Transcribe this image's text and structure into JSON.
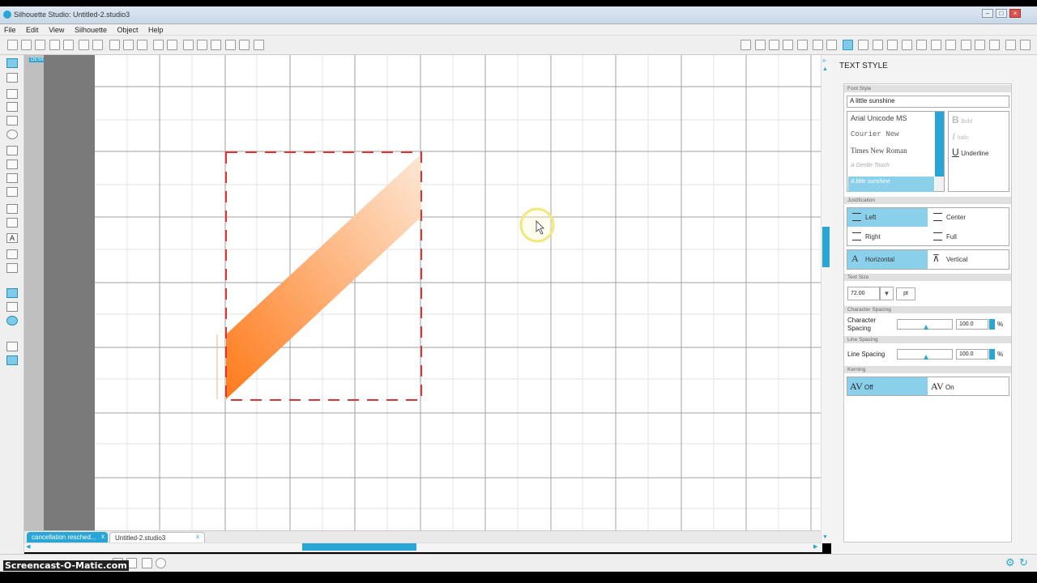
{
  "window": {
    "title": "Silhouette Studio: Untitled-2.studio3"
  },
  "menu": [
    "File",
    "Edit",
    "View",
    "Silhouette",
    "Object",
    "Help"
  ],
  "design_view_label": "DESIGN VIEW",
  "tabs": [
    {
      "label": "cancellation resched...",
      "close": "x"
    },
    {
      "label": "Untitled-2.studio3",
      "close": "x"
    }
  ],
  "watermark": "Screencast-O-Matic.com",
  "panel": {
    "title": "TEXT STYLE",
    "font_style_section": "Font Style",
    "font_value": "A little sunshine",
    "fonts": [
      "Arial Unicode MS",
      "Courier New",
      "Times New Roman",
      "A Gentle Touch",
      "A little sunshine"
    ],
    "style_buttons": [
      {
        "glyph": "B",
        "label": "Bold"
      },
      {
        "glyph": "I",
        "label": "Italic"
      },
      {
        "glyph": "U",
        "label": "Underline"
      }
    ],
    "justification_section": "Justification",
    "justify": [
      {
        "label": "Left",
        "selected": true
      },
      {
        "label": "Center",
        "selected": false
      },
      {
        "label": "Right",
        "selected": false
      },
      {
        "label": "Full",
        "selected": false
      }
    ],
    "orientation": [
      {
        "label": "Horizontal",
        "selected": true
      },
      {
        "label": "Vertical",
        "selected": false
      }
    ],
    "text_size_section": "Text Size",
    "text_size": "72.00",
    "text_size_unit": "pt",
    "char_spacing_section": "Character Spacing",
    "char_spacing_label": "Character Spacing",
    "char_spacing_value": "100.0",
    "line_spacing_section": "Line Spacing",
    "line_spacing_label": "Line Spacing",
    "line_spacing_value": "100.0",
    "percent": "%",
    "kerning_section": "Kerning",
    "kerning": [
      {
        "glyph": "AV",
        "label": "Off",
        "selected": true
      },
      {
        "glyph": "AV",
        "label": "On",
        "selected": false
      }
    ]
  },
  "colors": {
    "accent": "#2aa6d6",
    "selection_dash": "#e03030",
    "shape_dark": "#ff7a1a",
    "shape_light": "#fde8d6"
  }
}
